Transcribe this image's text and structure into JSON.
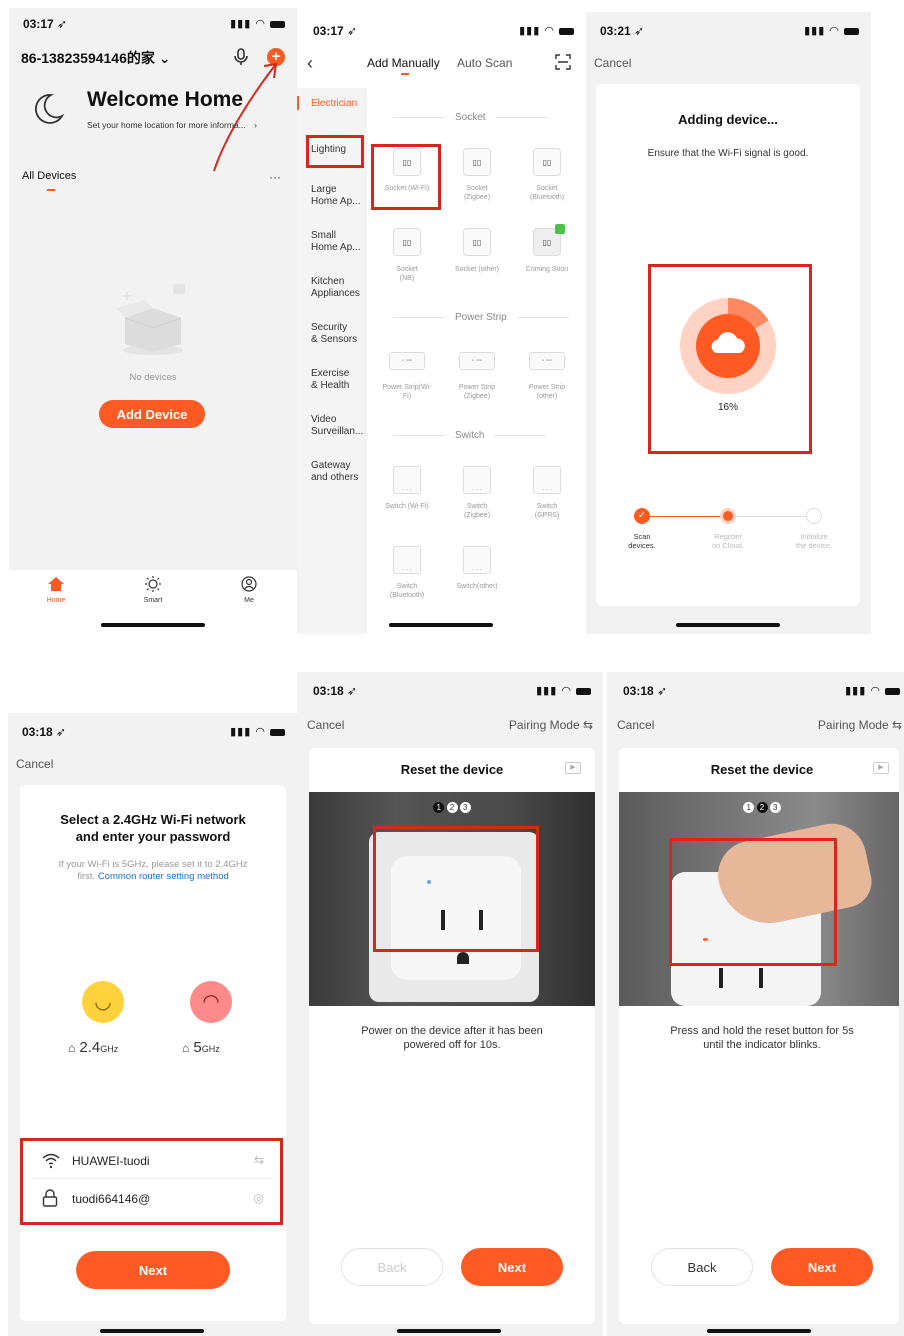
{
  "colors": {
    "accent": "#ff5a23",
    "highlight": "#d7261e",
    "link": "#1a6fd6",
    "screen_bg": "#f2f2f2"
  },
  "s1": {
    "time": "03:17",
    "home_name": "86-13823594146的家",
    "welcome": "Welcome Home",
    "location_hint": "Set your home location for more informa...",
    "all_devices": "All Devices",
    "more": "···",
    "empty": "No devices",
    "add_device": "Add Device",
    "tabs": [
      {
        "label": "Home"
      },
      {
        "label": "Smart"
      },
      {
        "label": "Me"
      }
    ]
  },
  "s2": {
    "time": "03:17",
    "tab_manual": "Add Manually",
    "tab_scan": "Auto Scan",
    "categories": [
      {
        "label": "Electrician"
      },
      {
        "label": "Lighting"
      },
      {
        "label": "Large\nHome Ap..."
      },
      {
        "label": "Small\nHome Ap..."
      },
      {
        "label": "Kitchen\nAppliances"
      },
      {
        "label": "Security\n& Sensors"
      },
      {
        "label": "Exercise\n& Health"
      },
      {
        "label": "Video\nSurveillan..."
      },
      {
        "label": "Gateway\nand others"
      }
    ],
    "sec_socket": "Socket",
    "sec_strip": "Power Strip",
    "sec_switch": "Switch",
    "sockets": [
      {
        "label": "Socket (Wi-Fi)"
      },
      {
        "label": "Socket\n(Zigbee)"
      },
      {
        "label": "Socket\n(Bluetooth)"
      },
      {
        "label": "Socket\n(NB)"
      },
      {
        "label": "Socket (other)"
      },
      {
        "label": "Coming Soon"
      }
    ],
    "strips": [
      {
        "label": "Power Strip(Wi-\nFi)"
      },
      {
        "label": "Power Strip\n(Zigbee)"
      },
      {
        "label": "Power Strip\n(other)"
      }
    ],
    "switches": [
      {
        "label": "Switch (Wi-Fi)"
      },
      {
        "label": "Switch\n(Zigbee)"
      },
      {
        "label": "Switch\n(GPRS)"
      },
      {
        "label": "Switch\n(Bluetooth)"
      },
      {
        "label": "Switch(other)"
      }
    ]
  },
  "s3": {
    "time": "03:21",
    "cancel": "Cancel",
    "title": "Adding device...",
    "subtitle": "Ensure that the Wi-Fi signal is good.",
    "progress": 16,
    "progress_label": "16%",
    "steps": [
      {
        "label": "Scan\ndevices."
      },
      {
        "label": "Register\non Cloud."
      },
      {
        "label": "Initialize\nthe device."
      }
    ]
  },
  "s4": {
    "time": "03:18",
    "cancel": "Cancel",
    "title": "Select a 2.4GHz Wi-Fi network\nand enter your password",
    "hint": "If your Wi-Fi is 5GHz, please set it to 2.4GHz\nfirst.",
    "link": "Common router setting method",
    "band_24": "2.4",
    "band_5": "5",
    "band_unit": "GHz",
    "ssid": "HUAWEI-tuodi",
    "password": "tuodi664146@",
    "next": "Next"
  },
  "s5": {
    "time": "03:18",
    "cancel": "Cancel",
    "mode": "Pairing Mode ⇆",
    "title": "Reset the device",
    "steps": [
      "1",
      "2",
      "3"
    ],
    "desc": "Power on the device after it has been\npowered off for 10s.",
    "back": "Back",
    "next": "Next"
  },
  "s6": {
    "time": "03:18",
    "cancel": "Cancel",
    "mode": "Pairing Mode ⇆",
    "title": "Reset the device",
    "steps": [
      "1",
      "2",
      "3"
    ],
    "desc": "Press and hold the reset button for 5s\nuntil the indicator blinks.",
    "back": "Back",
    "next": "Next"
  }
}
